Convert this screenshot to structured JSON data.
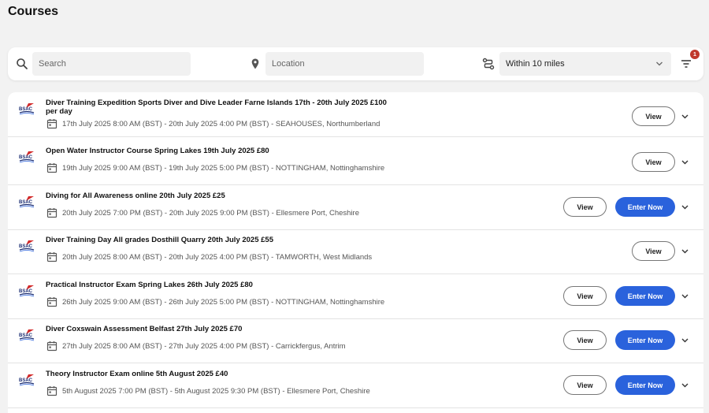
{
  "page": {
    "title": "Courses"
  },
  "search": {
    "search_placeholder": "Search",
    "location_placeholder": "Location",
    "distance_value": "Within 10 miles",
    "filter_count": "1"
  },
  "brand": {
    "logo_text": "BSAC",
    "accent": "#2a62dc",
    "badge_color": "#c0392b"
  },
  "buttons": {
    "view_label": "View",
    "enter_label": "Enter Now"
  },
  "courses": [
    {
      "title": "Diver Training Expedition Sports Diver and Dive Leader Farne Islands 17th - 20th July 2025 £100 per day",
      "dates": "17th July 2025 8:00 AM (BST) - 20th July 2025 4:00 PM (BST) - SEAHOUSES, Northumberland",
      "enter_available": false
    },
    {
      "title": "Open Water Instructor Course Spring Lakes 19th July 2025 £80",
      "dates": "19th July 2025 9:00 AM (BST) - 19th July 2025 5:00 PM (BST) - NOTTINGHAM, Nottinghamshire",
      "enter_available": false
    },
    {
      "title": "Diving for All Awareness online 20th July 2025 £25",
      "dates": "20th July 2025 7:00 PM (BST) - 20th July 2025 9:00 PM (BST) - Ellesmere Port, Cheshire",
      "enter_available": true
    },
    {
      "title": "Diver Training Day All grades Dosthill Quarry 20th July 2025 £55",
      "dates": "20th July 2025 8:00 AM (BST) - 20th July 2025 4:00 PM (BST) - TAMWORTH, West Midlands",
      "enter_available": false
    },
    {
      "title": "Practical Instructor Exam Spring Lakes 26th July 2025 £80",
      "dates": "26th July 2025 9:00 AM (BST) - 26th July 2025 5:00 PM (BST) - NOTTINGHAM, Nottinghamshire",
      "enter_available": true
    },
    {
      "title": "Diver Coxswain Assessment Belfast 27th July 2025 £70",
      "dates": "27th July 2025 8:00 AM (BST) - 27th July 2025 4:00 PM (BST) - Carrickfergus, Antrim",
      "enter_available": true
    },
    {
      "title": "Theory Instructor Exam online 5th August 2025 £40",
      "dates": "5th August 2025 7:00 PM (BST) - 5th August 2025 9:30 PM (BST) - Ellesmere Port, Cheshire",
      "enter_available": true
    }
  ]
}
